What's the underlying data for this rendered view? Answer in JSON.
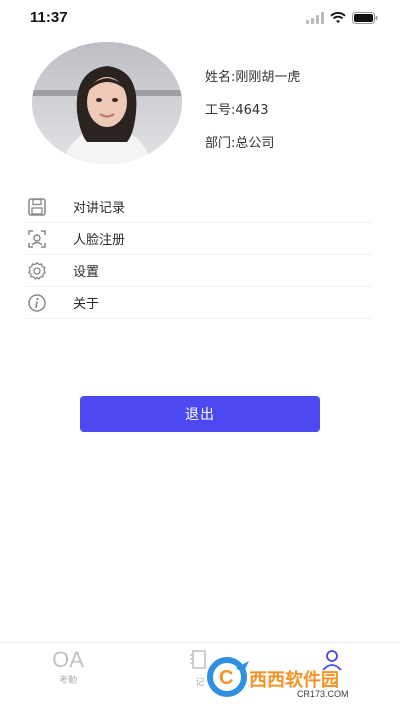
{
  "status_bar": {
    "time": "11:37"
  },
  "profile": {
    "name_line": "姓名:刚刚胡一虎",
    "employee_no_line": "工号:4643",
    "department_line": "部门:总公司"
  },
  "menu": {
    "items": [
      {
        "label": "对讲记录",
        "icon": "save-icon"
      },
      {
        "label": "人脸注册",
        "icon": "face-scan-icon"
      },
      {
        "label": "设置",
        "icon": "gear-icon"
      },
      {
        "label": "关于",
        "icon": "info-icon"
      }
    ]
  },
  "logout": {
    "label": "退出"
  },
  "tabbar": {
    "tabs": [
      {
        "icon_text": "OA",
        "label": "考勤"
      },
      {
        "icon": "document-icon",
        "label": "记"
      },
      {
        "icon": "person-icon",
        "label": ""
      }
    ],
    "active_color": "#4b49ef",
    "inactive_color": "#c2c2c2"
  },
  "watermark": {
    "brand": "西西软件园",
    "url": "CR173.COM"
  },
  "colors": {
    "accent": "#4b49ef",
    "watermark_orange": "#f29427"
  }
}
